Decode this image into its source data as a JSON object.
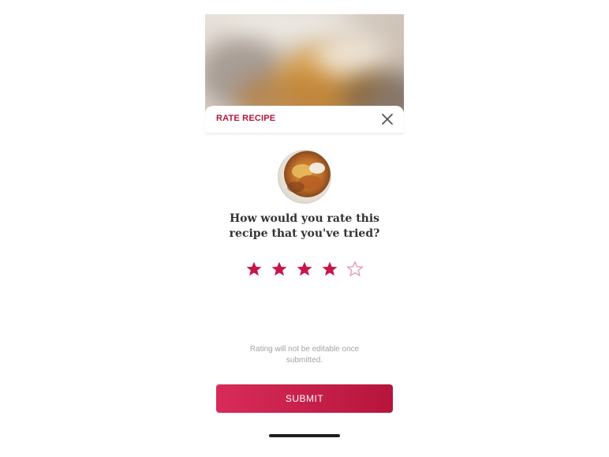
{
  "sheet": {
    "title": "RATE RECIPE",
    "close_icon": "close-icon"
  },
  "rating": {
    "question": "How would you rate this recipe that you've tried?",
    "selected_stars": 4,
    "max_stars": 5
  },
  "note": "Rating will not be editable once submitted.",
  "submit_label": "SUBMIT",
  "colors": {
    "accent": "#b3163a",
    "star_filled": "#c8154a",
    "star_empty_outline": "#e7a1b6",
    "button_gradient_start": "#d82b5a",
    "button_gradient_end": "#b6153b"
  }
}
